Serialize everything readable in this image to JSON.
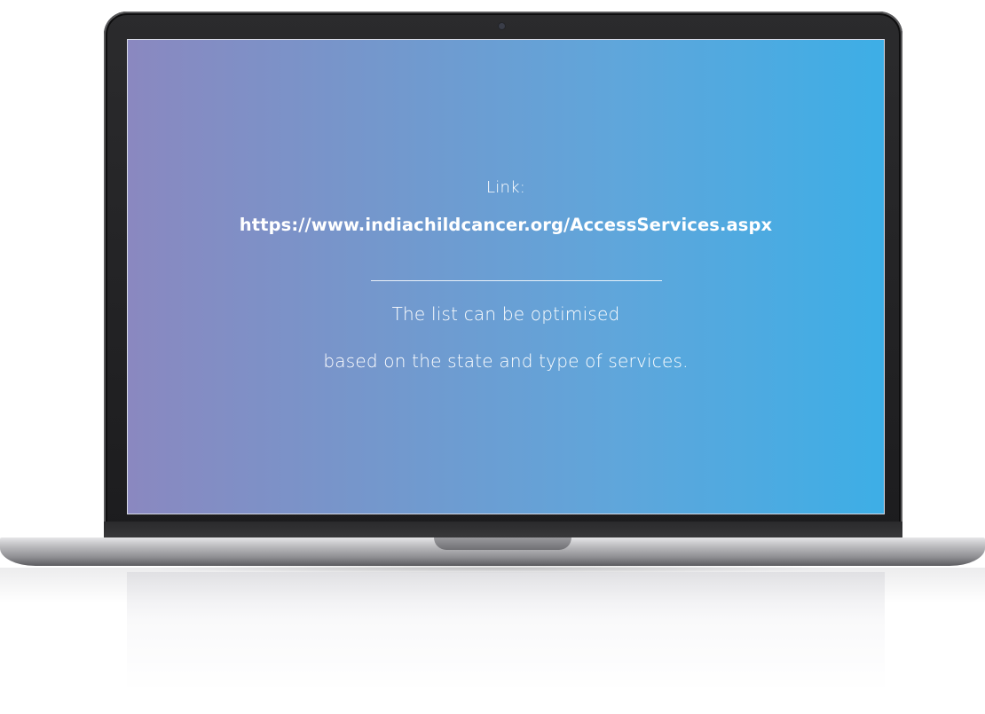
{
  "screen": {
    "link_label": "Link:",
    "link_url": "https://www.indiachildcancer.org/AccessServices.aspx",
    "note_line_1": "The list can be optimised",
    "note_line_2": "based on the state and type of services."
  },
  "colors": {
    "gradient_start": "#8a88c0",
    "gradient_end": "#3daee6",
    "text": "#ffffff",
    "bezel": "#1c1c1e"
  },
  "icons": {
    "camera": "camera-icon"
  }
}
